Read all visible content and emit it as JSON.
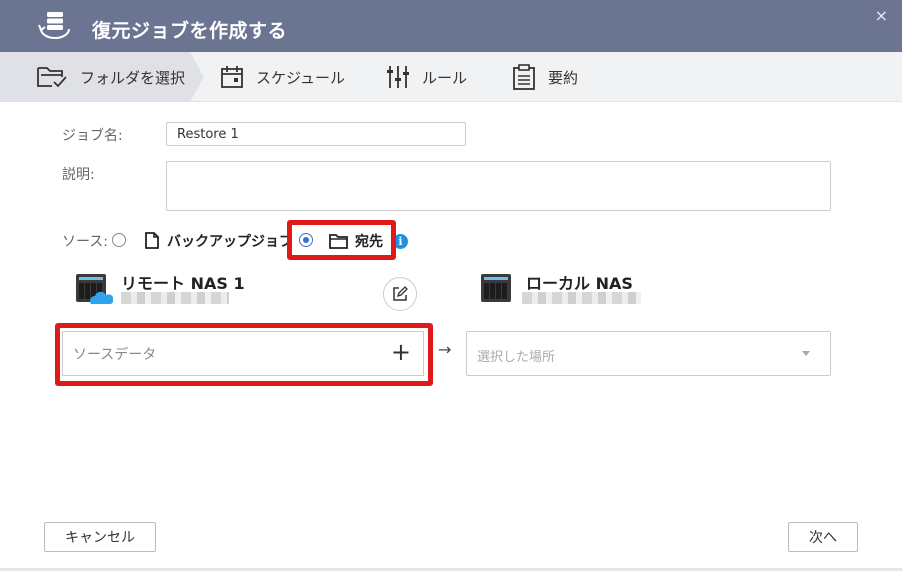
{
  "window": {
    "title": "復元ジョブを作成する",
    "close_glyph": "×"
  },
  "steps": [
    {
      "label": "フォルダを選択",
      "icon": "folder-check-icon",
      "active": true
    },
    {
      "label": "スケジュール",
      "icon": "calendar-icon",
      "active": false
    },
    {
      "label": "ルール",
      "icon": "sliders-icon",
      "active": false
    },
    {
      "label": "要約",
      "icon": "clipboard-icon",
      "active": false
    }
  ],
  "form": {
    "job_name_label": "ジョブ名:",
    "job_name_value": "Restore 1",
    "description_label": "説明:",
    "description_value": "",
    "source_label": "ソース:",
    "source_options": [
      {
        "label": "バックアップジョブ",
        "icon": "document-icon",
        "checked": false
      },
      {
        "label": "宛先",
        "icon": "folder-icon",
        "checked": true
      }
    ],
    "info_glyph": "i"
  },
  "remote_nas": {
    "name": "リモート NAS 1",
    "icon": "cloud-nas-icon"
  },
  "local_nas": {
    "name": "ローカル NAS",
    "icon": "nas-icon"
  },
  "source_data": {
    "placeholder": "ソースデータ",
    "add_glyph": "+"
  },
  "arrow_glyph": "→",
  "destination": {
    "placeholder": "選択した場所"
  },
  "footer": {
    "cancel_label": "キャンセル",
    "next_label": "次へ"
  },
  "colors": {
    "titlebar": "#6b7592",
    "accent": "#3a6fd8",
    "highlight": "#e01a1a",
    "info": "#1e8fe1"
  }
}
